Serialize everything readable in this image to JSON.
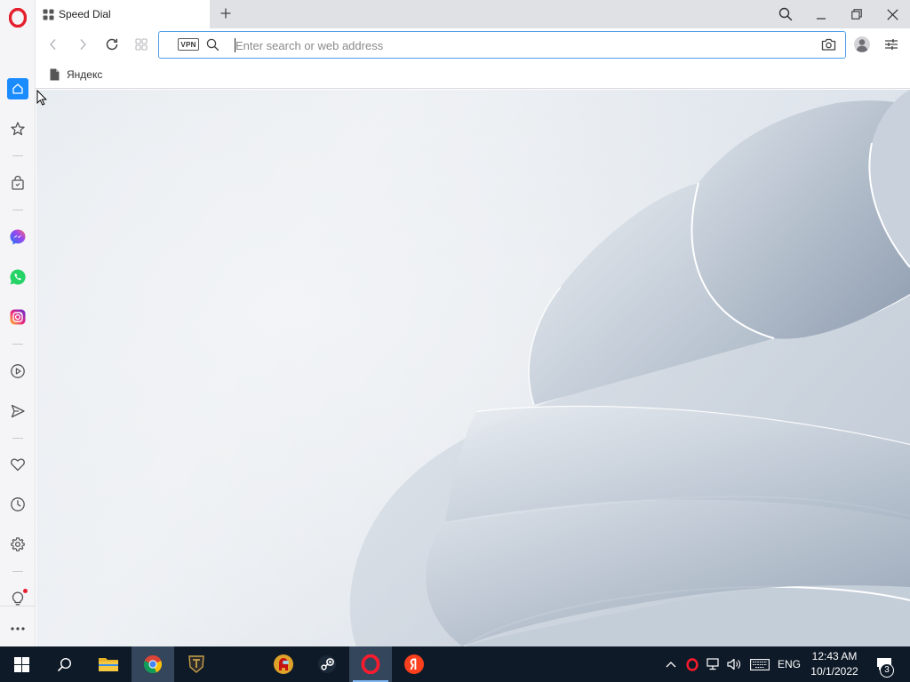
{
  "browser": {
    "tab": {
      "title": "Speed Dial"
    },
    "address_bar": {
      "placeholder": "Enter search or web address",
      "value": "",
      "vpn_label": "VPN"
    },
    "bookmarks": [
      {
        "label": "Яндекс"
      }
    ]
  },
  "sidebar": {
    "items": [
      "opera-logo",
      "speed-dial-home",
      "bookmarks-star",
      "my-flow-bag",
      "messenger",
      "whatsapp",
      "instagram",
      "player",
      "send-flow",
      "favorites-heart",
      "history-clock",
      "settings-gear",
      "tips-lightbulb",
      "more-menu"
    ]
  },
  "taskbar": {
    "apps": [
      "file-explorer",
      "chrome",
      "world-of-tanks",
      "among-us",
      "steam",
      "opera",
      "yandex-browser"
    ],
    "tray": {
      "language": "ENG",
      "time": "12:43 AM",
      "date": "10/1/2022",
      "notifications": "3"
    }
  },
  "colors": {
    "accent": "#1a8cff",
    "opera_red": "#e5202e",
    "taskbar": "#0f1a28"
  }
}
